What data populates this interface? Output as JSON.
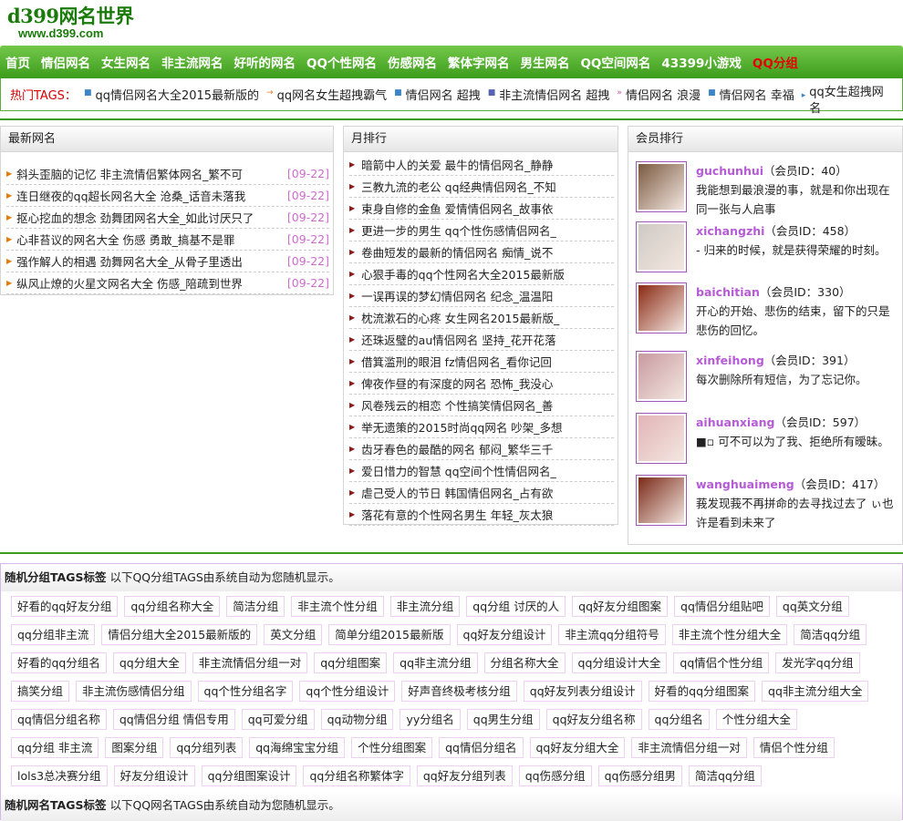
{
  "logo": {
    "text": "d399网名世界",
    "url_text": "www.d399.com"
  },
  "nav": [
    "首页",
    "情侣网名",
    "女生网名",
    "非主流网名",
    "好听的网名",
    "QQ个性网名",
    "伤感网名",
    "繁体字网名",
    "男生网名",
    "QQ空间网名",
    "43399小游戏",
    "QQ分组"
  ],
  "hot": {
    "label": "热门TAGS：",
    "tags": [
      "qq情侣网名大全2015最新版的",
      "qq网名女生超拽霸气",
      "情侣网名 超拽",
      "非主流情侣网名 超拽",
      "情侣网名 浪漫",
      "情侣网名 幸福",
      "qq女生超拽网名"
    ]
  },
  "newest": {
    "title": "最新网名",
    "items": [
      {
        "t": "斜头歪脑的记忆 非主流情侣繁体网名_繁不可",
        "d": "[09-22]"
      },
      {
        "t": "连日继夜的qq超长网名大全 沧桑_话音未落我",
        "d": "[09-22]"
      },
      {
        "t": "抠心挖血的想念 劲舞团网名大全_如此讨厌只了",
        "d": "[09-22]"
      },
      {
        "t": "心非苔议的网名大全 伤感 勇敢_搞基不是罪",
        "d": "[09-22]"
      },
      {
        "t": "强作解人的相遇 劲舞网名大全_从骨子里透出",
        "d": "[09-22]"
      },
      {
        "t": "纵风止燎的火星文网名大全 伤感_陪疏到世界",
        "d": "[09-22]"
      }
    ]
  },
  "month": {
    "title": "月排行",
    "items": [
      "暗箭中人的关爱 最牛的情侣网名_静静",
      "三教九流的老公 qq经典情侣网名_不知",
      "束身自修的金鱼 爱情情侣网名_故事依",
      "更进一步的男生 qq个性伤感情侣网名_",
      "卷曲短发的最新的情侣网名 痴情_说不",
      "心狠手毒的qq个性网名大全2015最新版",
      "一误再误的梦幻情侣网名 纪念_温温阳",
      "枕流漱石的心疼 女生网名2015最新版_",
      "还珠返璧的au情侣网名 坚持_花开花落",
      "借箕滥刑的眼泪 fz情侣网名_看你记回",
      "俾夜作昼的有深度的网名 恐怖_我没心",
      "风卷残云的相恋 个性搞笑情侣网名_善",
      "举无遗策的2015时尚qq网名 吵架_多想",
      "齿牙春色的最酷的网名 郁闷_繁华三千",
      "爱日惜力的智慧 qq空间个性情侣网名_",
      "虐己受人的节日 韩国情侣网名_占有欲",
      "落花有意的个性网名男生 年轻_灰太狼"
    ]
  },
  "members": {
    "title": "会员排行",
    "list": [
      {
        "name": "guchunhui",
        "id": "（会员ID：40）",
        "bio": "我能想到最浪漫的事，就是和你出现在同一张与人启事",
        "bg": "#7a5a40"
      },
      {
        "name": "xichangzhi",
        "id": "（会员ID：458）",
        "bio": "- 归来的时候，就是获得荣耀的时刻。",
        "bg": "#cfcac4"
      },
      {
        "name": "baichitian",
        "id": "（会员ID：330）",
        "bio": "开心的开始、悲伤的结束，留下的只是悲伤的回忆。",
        "bg": "#8a2a14"
      },
      {
        "name": "xinfeihong",
        "id": "（会员ID：391）",
        "bio": "每次删除所有短信，为了忘记你。",
        "bg": "#c89aa0"
      },
      {
        "name": "aihuanxiang",
        "id": "（会员ID：597）",
        "bio": "■▫ 可不可以为了我、拒绝所有暧昧。",
        "bg": "#e2b4b8"
      },
      {
        "name": "wanghuaimeng",
        "id": "（会员ID：417）",
        "bio": "莪发现莪不再拼命的去寻找过去了 ぃ也许是看到未来了",
        "bg": "#7a2a18"
      }
    ]
  },
  "tags": {
    "title": "随机分组TAGS标签",
    "desc": " 以下QQ分组TAGS由系统自动为您随机显示。",
    "list": [
      "好看的qq好友分组",
      "qq分组名称大全",
      "简洁分组",
      "非主流个性分组",
      "非主流分组",
      "qq分组 讨厌的人",
      "qq好友分组图案",
      "qq情侣分组贴吧",
      "qq英文分组",
      "qq分组非主流",
      "情侣分组大全2015最新版的",
      "英文分组",
      "简单分组2015最新版",
      "qq好友分组设计",
      "非主流qq分组符号",
      "非主流个性分组大全",
      "简洁qq分组",
      "好看的qq分组名",
      "qq分组大全",
      "非主流情侣分组一对",
      "qq分组图案",
      "qq非主流分组",
      "分组名称大全",
      "qq分组设计大全",
      "qq情侣个性分组",
      "发光字qq分组",
      "搞笑分组",
      "非主流伤感情侣分组",
      "qq个性分组名字",
      "qq个性分组设计",
      "好声音终极考核分组",
      "qq好友列表分组设计",
      "好看的qq分组图案",
      "qq非主流分组大全",
      "qq情侣分组名称",
      "qq情侣分组 情侣专用",
      "qq可爱分组",
      "qq动物分组",
      "yy分组名",
      "qq男生分组",
      "qq好友分组名称",
      "qq分组名",
      "个性分组大全",
      "qq分组 非主流",
      "图案分组",
      "qq分组列表",
      "qq海绵宝宝分组",
      "个性分组图案",
      "qq情侣分组名",
      "qq好友分组大全",
      "非主流情侣分组一对",
      "情侣个性分组",
      "lols3总决赛分组",
      "好友分组设计",
      "qq分组图案设计",
      "qq分组名称繁体字",
      "qq好友分组列表",
      "qq伤感分组",
      "qq伤感分组男",
      "简洁qq分组"
    ]
  },
  "tags2": {
    "title": "随机网名TAGS标签",
    "desc": " 以下QQ网名TAGS由系统自动为您随机显示。"
  }
}
